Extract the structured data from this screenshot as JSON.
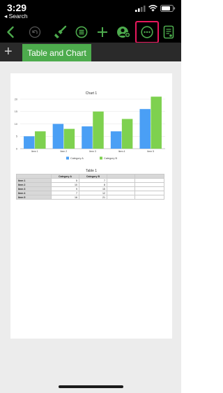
{
  "status": {
    "time": "3:29",
    "back_label": "◂ Search"
  },
  "colors": {
    "accent": "#4dab4d",
    "highlight": "#e8175d",
    "series_a": "#4a9ff5",
    "series_b": "#7ed14f"
  },
  "toolbar": {
    "icons": [
      "back-chevron-icon",
      "undo-icon",
      "brush-icon",
      "insert-list-icon",
      "add-icon",
      "collaborate-icon",
      "more-options-icon",
      "document-view-icon"
    ]
  },
  "sheets": {
    "add_label": "+",
    "active_tab": "Table and Chart"
  },
  "chart_data": {
    "type": "bar",
    "title": "Chart 1",
    "categories": [
      "Item 1",
      "Item 2",
      "Item 3",
      "Item 4",
      "Item 5"
    ],
    "series": [
      {
        "name": "Category A",
        "values": [
          5,
          10,
          9,
          7,
          16
        ]
      },
      {
        "name": "Category B",
        "values": [
          7,
          8,
          15,
          12,
          21
        ]
      }
    ],
    "yticks": [
      "0",
      "5",
      "10",
      "15",
      "20"
    ],
    "ylim": [
      0,
      20
    ],
    "legend": "bottom",
    "grid": true
  },
  "table": {
    "title": "Table 1",
    "headers": [
      "",
      "Category A",
      "Category B",
      "",
      ""
    ],
    "rows": [
      [
        "Item 1",
        "5",
        "7",
        "",
        ""
      ],
      [
        "Item 2",
        "10",
        "8",
        "",
        ""
      ],
      [
        "Item 3",
        "9",
        "15",
        "",
        ""
      ],
      [
        "Item 4",
        "7",
        "12",
        "",
        ""
      ],
      [
        "Item 5",
        "16",
        "21",
        "",
        ""
      ]
    ]
  }
}
